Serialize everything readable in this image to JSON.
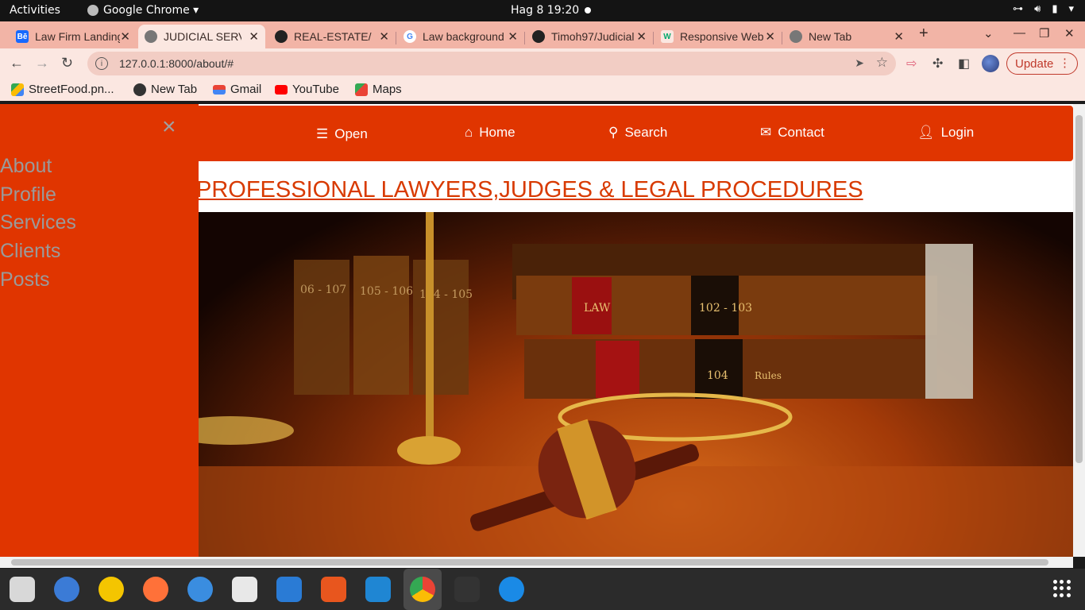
{
  "system_bar": {
    "activities": "Activities",
    "app_name": "Google Chrome ▾",
    "clock": "Hag 8  19:20"
  },
  "tabs": [
    {
      "label": "Law Firm Landing",
      "favicon": "behance-icon",
      "color": "#1769ff",
      "glyph": "Bē"
    },
    {
      "label": "JUDICIAL SERVICES",
      "favicon": "globe-icon",
      "color": "#666666",
      "glyph": ""
    },
    {
      "label": "REAL-ESTATE/",
      "favicon": "github-icon",
      "color": "#222222",
      "glyph": ""
    },
    {
      "label": "Law background",
      "favicon": "google-icon",
      "color": "#4285f4",
      "glyph": "G"
    },
    {
      "label": "Timoh97/Judicial",
      "favicon": "github-icon",
      "color": "#222222",
      "glyph": ""
    },
    {
      "label": "Responsive Web",
      "favicon": "w3-icon",
      "color": "#04aa6d",
      "glyph": "W"
    },
    {
      "label": "New Tab",
      "favicon": "chrome-icon",
      "color": "#777777",
      "glyph": ""
    }
  ],
  "toolbar": {
    "url": "127.0.0.1:8000/about/#",
    "update_label": "Update"
  },
  "bookmarks": [
    {
      "label": "StreetFood.pn...",
      "icon": "drive-icon"
    },
    {
      "label": "New Tab",
      "icon": "globe-icon"
    },
    {
      "label": "Gmail",
      "icon": "gmail-icon"
    },
    {
      "label": "YouTube",
      "icon": "youtube-icon"
    },
    {
      "label": "Maps",
      "icon": "maps-icon"
    }
  ],
  "sidenav": {
    "close_glyph": "×",
    "links": [
      "About",
      "Profile",
      "Services",
      "Clients",
      "Posts"
    ]
  },
  "navbar": {
    "items": [
      {
        "label": "Open",
        "icon": "menu-icon"
      },
      {
        "label": "Home",
        "icon": "home-icon"
      },
      {
        "label": "Search",
        "icon": "search-icon"
      },
      {
        "label": "Contact",
        "icon": "envelope-icon"
      },
      {
        "label": "Login",
        "icon": "user-icon"
      }
    ]
  },
  "headline": "PROFESSIONAL LAWYERS,JUDGES & LEGAL PROCEDURES",
  "hero": {
    "book_labels": [
      "06 - 107",
      "105 - 106",
      "104 - 105",
      "LAW",
      "102 - 103",
      "104",
      "Rules"
    ]
  },
  "colors": {
    "brand": "#e03500",
    "headline": "#d83a00",
    "tabstrip": "#f2b4a6"
  }
}
